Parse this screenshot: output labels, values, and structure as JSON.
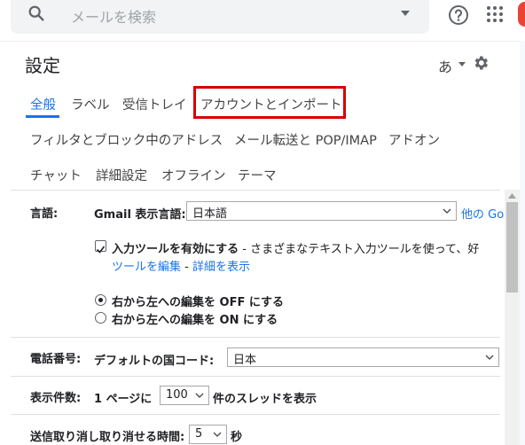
{
  "search": {
    "placeholder": "メールを検索"
  },
  "settings": {
    "title": "設定",
    "input_tool": "あ"
  },
  "tabs": [
    {
      "label": "全般"
    },
    {
      "label": "ラベル"
    },
    {
      "label": "受信トレイ"
    },
    {
      "label": "アカウントとインポート"
    },
    {
      "label": "フィルタとブロック中のアドレス"
    },
    {
      "label": "メール転送と POP/IMAP"
    },
    {
      "label": "アドオン"
    },
    {
      "label": "チャット"
    },
    {
      "label": "詳細設定"
    },
    {
      "label": "オフライン"
    },
    {
      "label": "テーマ"
    }
  ],
  "language": {
    "label": "言語:",
    "display_label": "Gmail 表示言語:",
    "display_value": "日本語",
    "other_link": "他の Go",
    "input_tools_bold": "入力ツールを有効にする",
    "input_tools_desc": " - さまざまなテキスト入力ツールを使って、好",
    "edit_tools_link": "ツールを編集",
    "separator": " - ",
    "details_link": "詳細を表示",
    "rtl_off": "右から左への編集を OFF にする",
    "rtl_on": "右から左への編集を ON にする"
  },
  "phone": {
    "label": "電話番号:",
    "country_label": "デフォルトの国コード:",
    "country_value": "日本"
  },
  "page_size": {
    "label": "表示件数:",
    "prefix": "1 ページに",
    "value": "100",
    "suffix": "件のスレッドを表示"
  },
  "undo_send": {
    "label": "送信取り消し",
    "period_label": "取り消せる時間:",
    "value": "5",
    "suffix": "秒"
  },
  "colors": {
    "accent": "#1a73e8",
    "highlight": "#d50000"
  }
}
